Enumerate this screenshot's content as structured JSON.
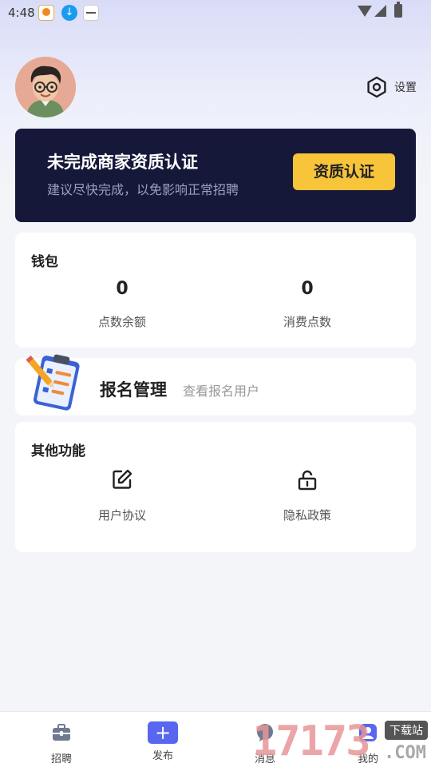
{
  "status_bar": {
    "time": "4:48",
    "icons": [
      "app-icon",
      "download-icon",
      "app-icon",
      "wifi-icon",
      "signal-icon",
      "battery-icon"
    ]
  },
  "profile": {
    "avatar_icon": "avatar",
    "settings_label": "设置",
    "settings_icon": "settings-icon"
  },
  "certification": {
    "title": "未完成商家资质认证",
    "subtitle": "建议尽快完成，以免影响正常招聘",
    "button_label": "资质认证"
  },
  "wallet": {
    "title": "钱包",
    "stats": [
      {
        "value": "0",
        "label": "点数余额"
      },
      {
        "value": "0",
        "label": "消费点数"
      }
    ]
  },
  "signup_management": {
    "title": "报名管理",
    "subtitle": "查看报名用户",
    "icon": "clipboard-icon"
  },
  "other_functions": {
    "title": "其他功能",
    "items": [
      {
        "label": "用户协议",
        "icon": "edit-icon"
      },
      {
        "label": "隐私政策",
        "icon": "unlock-icon"
      }
    ]
  },
  "tab_bar": {
    "tabs": [
      {
        "label": "招聘",
        "icon": "briefcase-icon"
      },
      {
        "label": "发布",
        "icon": "plus-icon"
      },
      {
        "label": "消息",
        "icon": "message-icon"
      },
      {
        "label": "我的",
        "icon": "profile-icon"
      }
    ]
  },
  "watermark": {
    "digits": "17173",
    "badge": "下载站",
    "suffix": ".COM"
  },
  "colors": {
    "banner_bg": "#16183a",
    "accent_yellow": "#f7c43a",
    "publish_blue": "#5866f0"
  }
}
